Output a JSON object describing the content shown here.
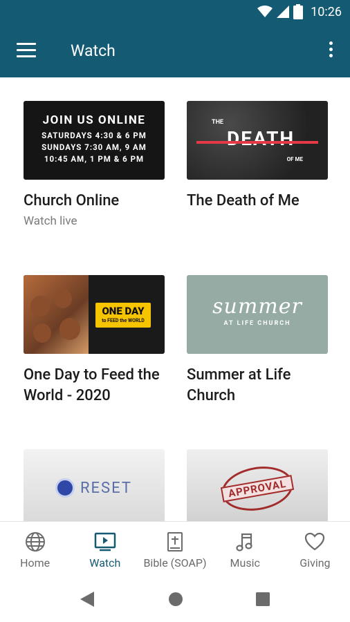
{
  "status_bar": {
    "time": "10:26"
  },
  "app_bar": {
    "title": "Watch"
  },
  "cards": [
    {
      "title": "Church Online",
      "subtitle": "Watch live",
      "thumb_heading": "JOIN US ONLINE",
      "thumb_lines": [
        "SATURDAYS 4:30 & 6 PM",
        "SUNDAYS 7:30 AM, 9 AM",
        "10:45 AM, 1 PM & 6 PM"
      ]
    },
    {
      "title": "The Death of Me",
      "thumb_lines": [
        "THE",
        "DEATH",
        "OF ME"
      ]
    },
    {
      "title": "One Day to Feed the World - 2020",
      "thumb_lines": [
        "ONE DAY",
        "to FEED the WORLD"
      ]
    },
    {
      "title": "Summer at Life Church",
      "thumb_lines": [
        "summer",
        "AT LIFE CHURCH"
      ]
    },
    {
      "thumb_lines": [
        "RESET"
      ]
    },
    {
      "thumb_lines": [
        "APPROVAL"
      ]
    }
  ],
  "bottom_nav": [
    {
      "label": "Home",
      "icon": "globe-icon"
    },
    {
      "label": "Watch",
      "icon": "tv-play-icon",
      "active": true
    },
    {
      "label": "Bible (SOAP)",
      "icon": "bible-icon"
    },
    {
      "label": "Music",
      "icon": "music-note-icon"
    },
    {
      "label": "Giving",
      "icon": "heart-icon"
    }
  ],
  "colors": {
    "primary": "#155a73",
    "inactive": "#6b6b6b"
  }
}
